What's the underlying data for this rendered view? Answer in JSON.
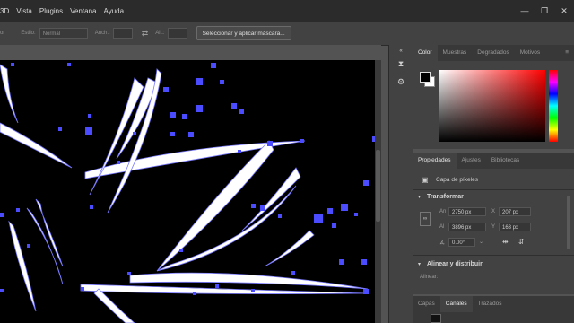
{
  "menubar": {
    "items": [
      "3D",
      "Vista",
      "Plugins",
      "Ventana",
      "Ayuda"
    ]
  },
  "options_bar": {
    "style_label": "Estilo:",
    "style_value": "Normal",
    "width_label": "Anch.:",
    "height_label": "Alt.:",
    "select_mask_button": "Seleccionar y aplicar máscara..."
  },
  "color_panel": {
    "tabs": [
      "Color",
      "Muestras",
      "Degradados",
      "Motivos"
    ],
    "active_tab": "Color"
  },
  "properties_panel": {
    "tabs": [
      "Propiedades",
      "Ajustes",
      "Bibliotecas"
    ],
    "active_tab": "Propiedades",
    "layer_type": "Capa de píxeles",
    "transform_heading": "Transformar",
    "fields": {
      "an_label": "An",
      "an_value": "2750 px",
      "x_label": "X",
      "x_value": "207 px",
      "al_label": "Al",
      "al_value": "3896 px",
      "y_label": "Y",
      "y_value": "163 px",
      "angle_value": "0.00°"
    },
    "align_heading": "Alinear y distribuir",
    "align_label": "Alinear:"
  },
  "layers_panel": {
    "tabs": [
      "Capas",
      "Canales",
      "Trazados"
    ],
    "active_tab": "Canales"
  }
}
